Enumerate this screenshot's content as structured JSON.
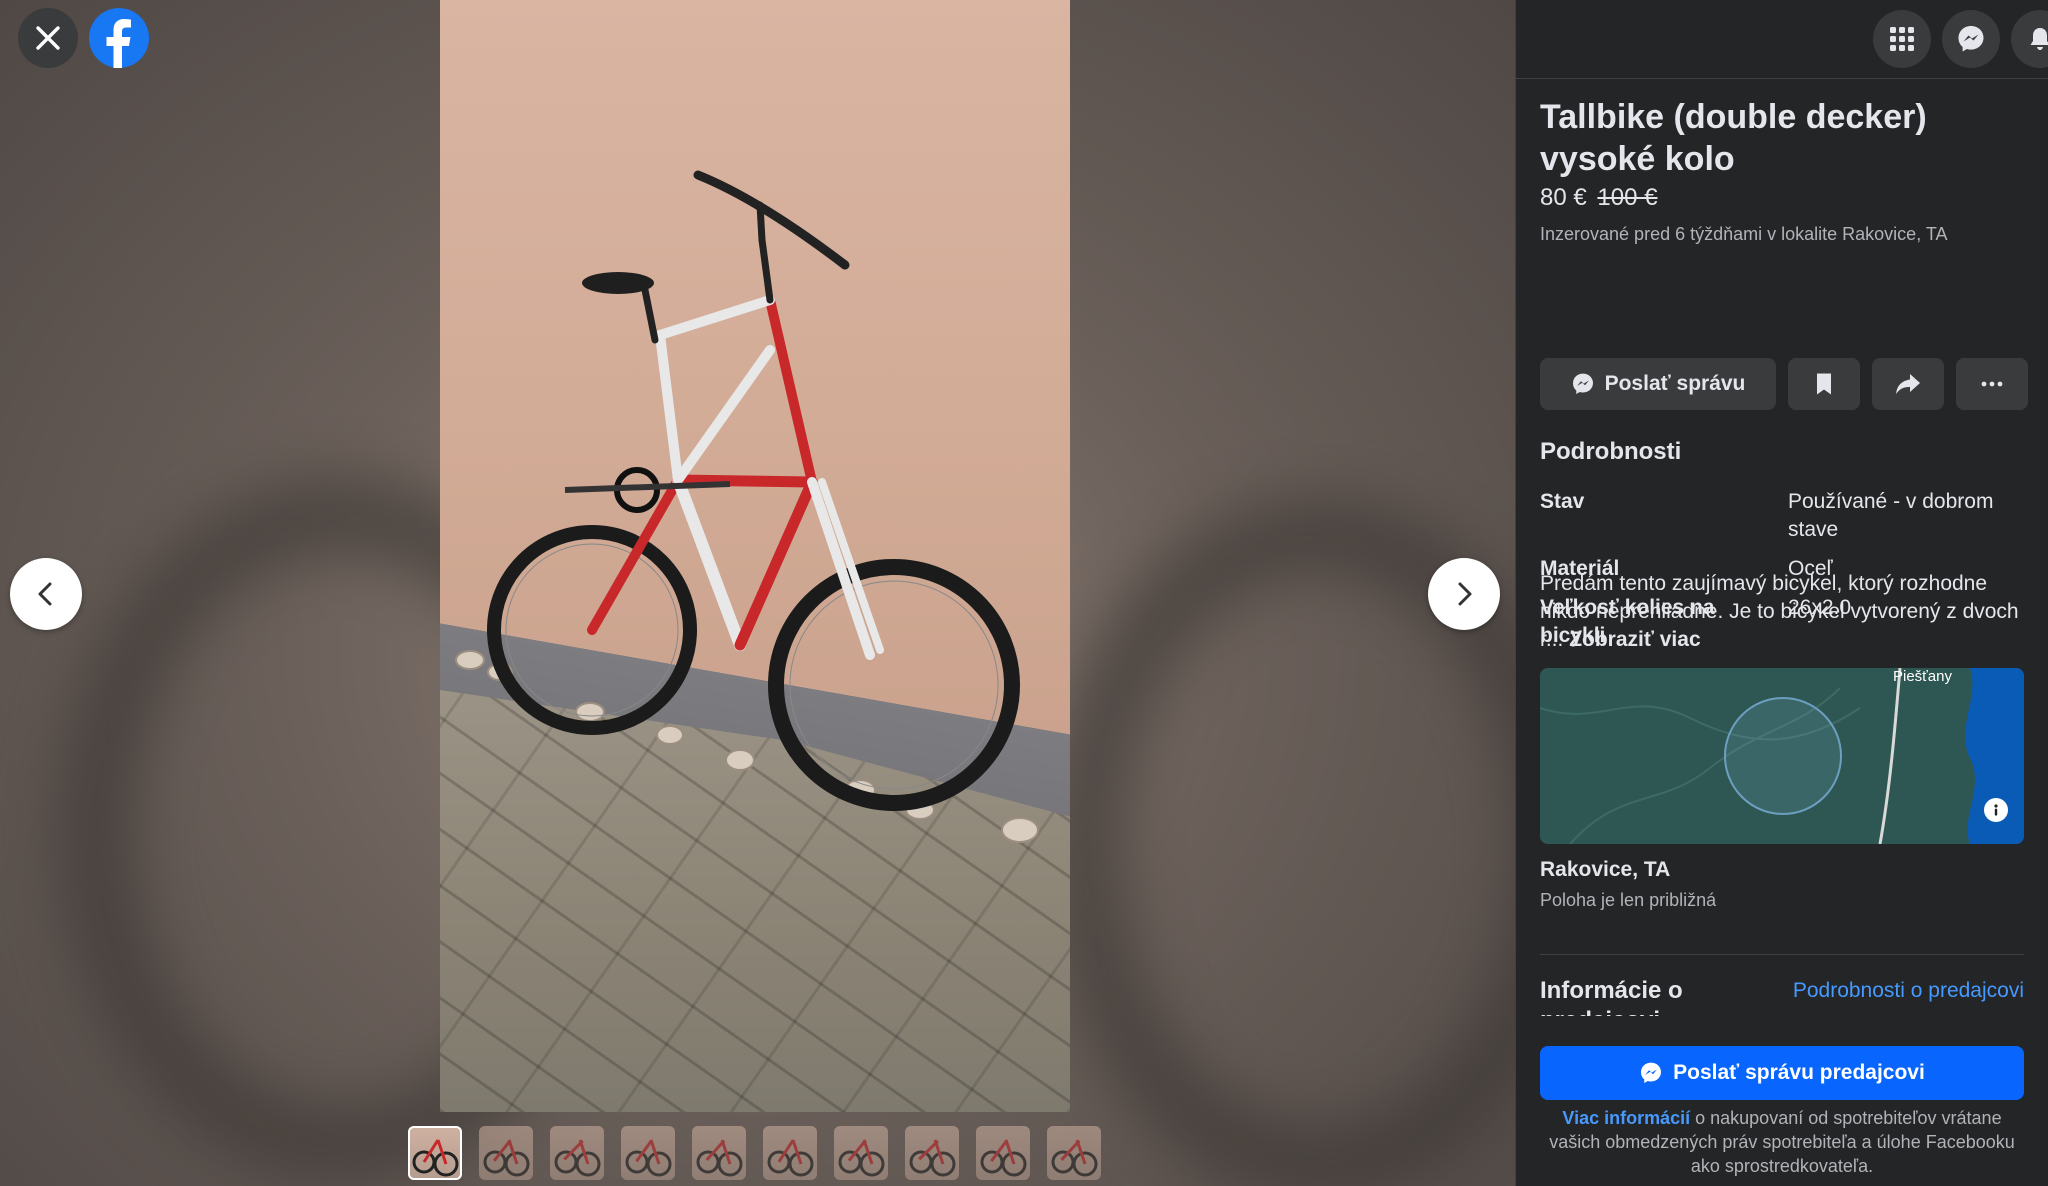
{
  "icons": {
    "close": "close-icon",
    "logo": "facebook-logo-icon",
    "prev": "chevron-left-icon",
    "next": "chevron-right-icon",
    "menu": "grid-menu-icon",
    "messenger": "messenger-icon",
    "notifications": "bell-icon",
    "save": "bookmark-icon",
    "share": "share-arrow-icon",
    "more": "more-dots-icon",
    "map_info": "info-icon"
  },
  "colors": {
    "panel_bg": "#242526",
    "button_bg": "#3a3b3c",
    "primary": "#0866ff",
    "link": "#4599ff",
    "secondary_text": "#b0b3b8"
  },
  "gallery": {
    "thumbnail_count": 10,
    "active_index": 0
  },
  "listing": {
    "title": "Tallbike (double decker) vysoké kolo",
    "price": "80 €",
    "old_price": "100 €",
    "posted": "Inzerované pred 6 týždňami v lokalite Rakovice, TA",
    "actions": {
      "send_message": "Poslať správu"
    },
    "details_heading": "Podrobnosti",
    "details": [
      {
        "key": "Stav",
        "value": "Používané - v dobrom stave"
      },
      {
        "key": "Materiál",
        "value": "Oceľ"
      },
      {
        "key": "Veľkosť kolies na bicykli",
        "value": "26x2.0"
      }
    ],
    "description": "Predám tento zaujímavý bicykel, ktorý rozhodne nikdo neprehliadne. Je to bicykel vytvorený z dvoch r...",
    "see_more": "Zobraziť viac",
    "map": {
      "label": "Piešťany"
    },
    "location": "Rakovice, TA",
    "location_note": "Poloha je len približná",
    "seller_heading": "Informácie o predajcovi",
    "seller_link": "Podrobnosti o predajcovi"
  },
  "footer": {
    "button": "Poslať správu predajcovi",
    "link": "Viac informácií",
    "note": " o nakupovaní od spotrebiteľov vrátane vašich obmedzených práv spotrebiteľa a úlohe Facebooku ako sprostredkovateľa."
  }
}
